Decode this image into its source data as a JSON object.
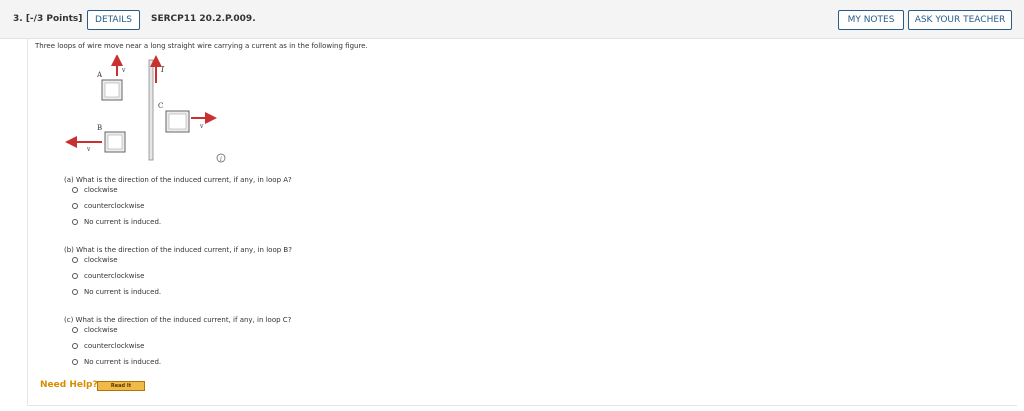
{
  "header": {
    "question_number": "3. [-/3 Points]",
    "details_label": "DETAILS",
    "code": "SERCP11 20.2.P.009.",
    "my_notes_label": "MY NOTES",
    "ask_teacher_label": "ASK YOUR TEACHER"
  },
  "intro": "Three loops of wire move near a long straight wire carrying a current as in the following figure.",
  "figure": {
    "label_a": "A",
    "label_b": "B",
    "label_c": "C",
    "label_current": "I",
    "label_v": "v",
    "info_glyph": "i",
    "arrow_color": "#c8312f"
  },
  "parts": [
    {
      "question": "(a) What is the direction of the induced current, if any, in loop A?",
      "options": [
        "clockwise",
        "counterclockwise",
        "No current is induced."
      ]
    },
    {
      "question": "(b) What is the direction of the induced current, if any, in loop B?",
      "options": [
        "clockwise",
        "counterclockwise",
        "No current is induced."
      ]
    },
    {
      "question": "(c) What is the direction of the induced current, if any, in loop C?",
      "options": [
        "clockwise",
        "counterclockwise",
        "No current is induced."
      ]
    }
  ],
  "help": {
    "need_help": "Need Help?",
    "read_it": "Read It"
  }
}
